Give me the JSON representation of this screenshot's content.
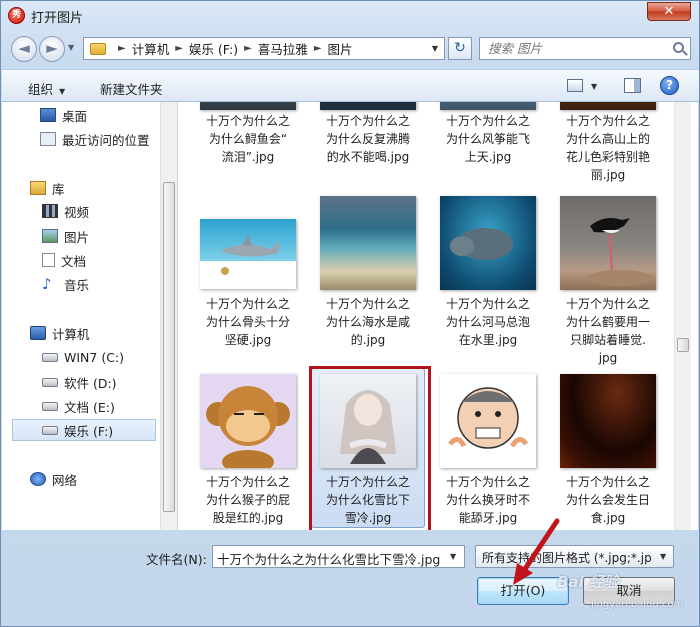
{
  "window": {
    "title": "打开图片",
    "app_icon": "秀",
    "close": "✕"
  },
  "nav": {
    "back": "◄",
    "forward": "►",
    "dropdown": "▼"
  },
  "address": {
    "crumbs": [
      "计算机",
      "娱乐 (F:)",
      "喜马拉雅",
      "图片"
    ],
    "separator": "►",
    "dropdown": "▼"
  },
  "refresh": "↻",
  "search": {
    "placeholder": "搜索 图片"
  },
  "toolbar": {
    "organize": "组织",
    "organize_caret": "▼",
    "new_folder": "新建文件夹",
    "view_caret": "▼",
    "help": "?"
  },
  "sidebar": {
    "items": [
      {
        "label": "桌面",
        "icon": "desktop-icon"
      },
      {
        "label": "最近访问的位置",
        "icon": "recent-places-icon"
      },
      {
        "label": "库",
        "icon": "library-icon"
      },
      {
        "label": "视频",
        "icon": "video-icon"
      },
      {
        "label": "图片",
        "icon": "pictures-icon"
      },
      {
        "label": "文档",
        "icon": "documents-icon"
      },
      {
        "label": "音乐",
        "icon": "music-icon",
        "glyph": "♪"
      },
      {
        "label": "计算机",
        "icon": "computer-icon"
      },
      {
        "label": "WIN7 (C:)",
        "icon": "drive-c-icon"
      },
      {
        "label": "软件 (D:)",
        "icon": "drive-d-icon"
      },
      {
        "label": "文档 (E:)",
        "icon": "drive-e-icon"
      },
      {
        "label": "娱乐 (F:)",
        "icon": "drive-f-icon",
        "selected": true
      },
      {
        "label": "网络",
        "icon": "network-icon"
      }
    ]
  },
  "files": [
    {
      "name": "十万个为什么之\n为什么鲟鱼会“\n流泪”.jpg"
    },
    {
      "name": "十万个为什么之\n为什么反复沸腾\n的水不能喝.jpg"
    },
    {
      "name": "十万个为什么之\n为什么风筝能飞\n上天.jpg"
    },
    {
      "name": "十万个为什么之\n为什么高山上的\n花儿色彩特别艳\n丽.jpg"
    },
    {
      "name": "十万个为什么之\n为什么骨头十分\n坚硬.jpg"
    },
    {
      "name": "十万个为什么之\n为什么海水是咸\n的.jpg"
    },
    {
      "name": "十万个为什么之\n为什么河马总泡\n在水里.jpg"
    },
    {
      "name": "十万个为什么之\n为什么鹤要用一\n只脚站着睡觉.\njpg"
    },
    {
      "name": "十万个为什么之\n为什么猴子的屁\n股是红的.jpg"
    },
    {
      "name": "十万个为什么之\n为什么化雪比下\n雪冷.jpg",
      "selected": true
    },
    {
      "name": "十万个为什么之\n为什么换牙时不\n能舔牙.jpg"
    },
    {
      "name": "十万个为什么之\n为什么会发生日\n食.jpg"
    }
  ],
  "footer": {
    "filename_label": "文件名(N):",
    "filename_value": "十万个为什么之为什么化雪比下雪冷.jpg",
    "filetype_value": "所有支持的图片格式 (*.jpg;*.jp",
    "dropdown": "▼",
    "open_button": "打开(O)",
    "cancel_button": "取消"
  },
  "watermark": {
    "text": "Bai 经验",
    "sub": "jingyan.baidu.com"
  },
  "colors": {
    "highlight_box": "#b4121a",
    "arrow": "#c2131b"
  }
}
